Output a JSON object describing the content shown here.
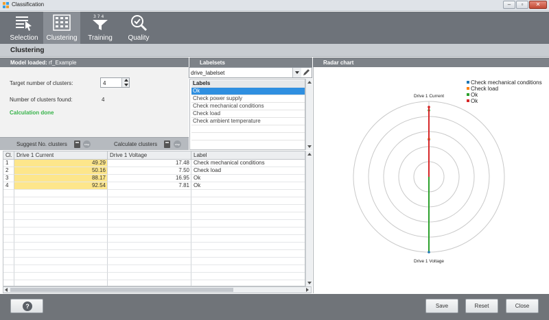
{
  "window": {
    "title": "Classification"
  },
  "toolbar": {
    "items": [
      {
        "label": "Selection",
        "icon": "list-cursor-icon"
      },
      {
        "label": "Clustering",
        "icon": "cluster-grid-icon"
      },
      {
        "label": "Training",
        "icon": "funnel-icon"
      },
      {
        "label": "Quality",
        "icon": "magnifier-check-icon"
      }
    ],
    "active": "Clustering"
  },
  "section": {
    "title": "Clustering"
  },
  "model": {
    "header_label": "Model loaded:",
    "header_value": "rf_Example"
  },
  "form": {
    "target_label": "Target number of clusters:",
    "target_value": "4",
    "found_label": "Number of clusters found:",
    "found_value": "4",
    "status": "Calculation done",
    "suggest_label": "Suggest No. clusters",
    "calculate_label": "Calculate clusters",
    "stop_label": "stop"
  },
  "labelsets": {
    "header": "Labelsets",
    "selected": "drive_labelset",
    "list_header": "Labels",
    "items": [
      "Ok",
      "Check power supply",
      "Check mechanical conditions",
      "Check load",
      "Check ambient temperature"
    ],
    "selected_item": "Ok"
  },
  "grid": {
    "columns": [
      "Cl.",
      "Drive 1 Current",
      "Drive 1 Voltage",
      "Label"
    ],
    "rows": [
      [
        "1",
        "49.29",
        "17.48",
        "Check mechanical conditions"
      ],
      [
        "2",
        "50.16",
        "7.50",
        "Check load"
      ],
      [
        "3",
        "88.17",
        "16.95",
        "Ok"
      ],
      [
        "4",
        "92.54",
        "7.81",
        "Ok"
      ]
    ]
  },
  "radar": {
    "header": "Radar chart",
    "axis_top": "Drive 1 Current",
    "axis_bottom": "Drive 1 Voltage",
    "legend": [
      {
        "label": "Check mechanical conditions",
        "color": "#1f77b4"
      },
      {
        "label": "Check load",
        "color": "#ff7f0e"
      },
      {
        "label": "Ok",
        "color": "#2ca02c"
      },
      {
        "label": "Ok",
        "color": "#d62728"
      }
    ]
  },
  "chart_data": {
    "type": "radar",
    "axes": [
      "Drive 1 Current",
      "Drive 1 Voltage"
    ],
    "rings": 5,
    "series": [
      {
        "name": "Check mechanical conditions",
        "color": "#1f77b4",
        "values": [
          49.29,
          17.48
        ]
      },
      {
        "name": "Check load",
        "color": "#ff7f0e",
        "values": [
          50.16,
          7.5
        ]
      },
      {
        "name": "Ok",
        "color": "#2ca02c",
        "values": [
          88.17,
          16.95
        ]
      },
      {
        "name": "Ok",
        "color": "#d62728",
        "values": [
          92.54,
          7.81
        ]
      }
    ]
  },
  "footer": {
    "help": "?",
    "save": "Save",
    "reset": "Reset",
    "close": "Close"
  }
}
